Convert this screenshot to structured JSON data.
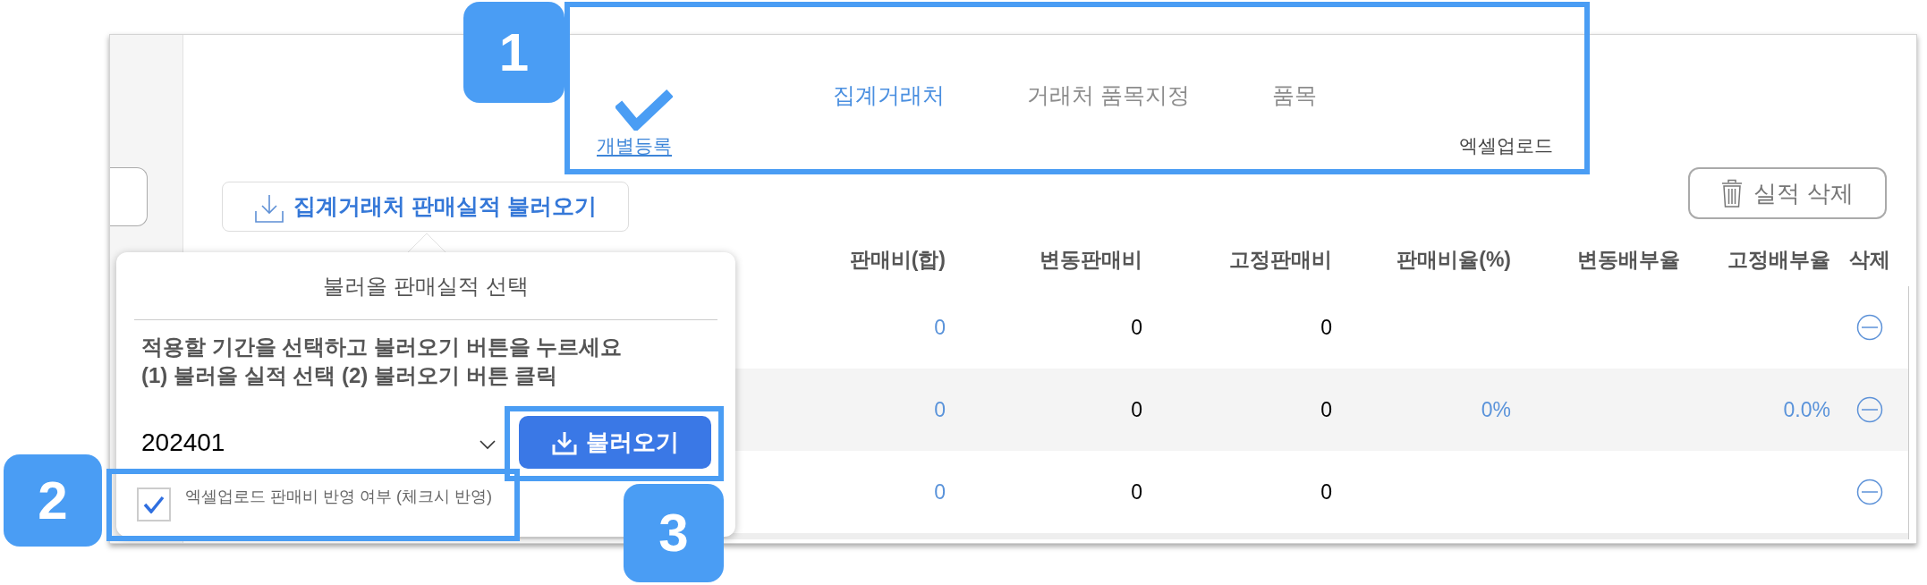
{
  "tabs": [
    {
      "label": "집계거래처",
      "selected": true
    },
    {
      "label": "거래처 품목지정",
      "selected": false
    },
    {
      "label": "품목",
      "selected": false
    }
  ],
  "entry_modes": [
    {
      "label": "개별등록",
      "selected": true
    },
    {
      "label": "엑셀업로드",
      "selected": false
    }
  ],
  "toolbar": {
    "load_button": "집계거래처 판매실적 불러오기",
    "delete_button": "실적 삭제"
  },
  "table": {
    "columns": [
      {
        "label": "판매비(합)",
        "kind": "computed"
      },
      {
        "label": "변동판매비",
        "kind": "input"
      },
      {
        "label": "고정판매비",
        "kind": "input"
      },
      {
        "label": "판매비율(%)",
        "kind": "computed"
      },
      {
        "label": "변동배부율",
        "kind": "computed"
      },
      {
        "label": "고정배부율",
        "kind": "computed"
      },
      {
        "label": "삭제",
        "kind": "action"
      }
    ],
    "rows": [
      {
        "selling_cost_total": "0",
        "variable_selling_cost": "0",
        "fixed_selling_cost": "0"
      },
      {
        "selling_cost_total": "0",
        "variable_selling_cost": "0",
        "fixed_selling_cost": "0",
        "selling_cost_ratio": "0%",
        "fixed_allocation_rate": "0.0%"
      },
      {
        "selling_cost_total": "0",
        "variable_selling_cost": "0",
        "fixed_selling_cost": "0"
      }
    ]
  },
  "popup": {
    "title": "불러올 판매실적 선택",
    "instructions": [
      "적용할 기간을 선택하고 불러오기 버튼을 누르세요",
      "(1) 불러올 실적 선택 (2) 불러오기 버튼 클릭"
    ],
    "period_select": {
      "value": "202401"
    },
    "load_button": "불러오기",
    "reflect_option": {
      "label": "엑셀업로드 판매비 반영 여부 (체크시 반영)",
      "checked": true
    }
  },
  "annotations": [
    {
      "kind": "numbered_frame",
      "label": "1"
    },
    {
      "kind": "numbered_frame",
      "label": "2"
    },
    {
      "kind": "numbered_frame",
      "label": "3"
    },
    {
      "kind": "check_mark"
    }
  ]
}
